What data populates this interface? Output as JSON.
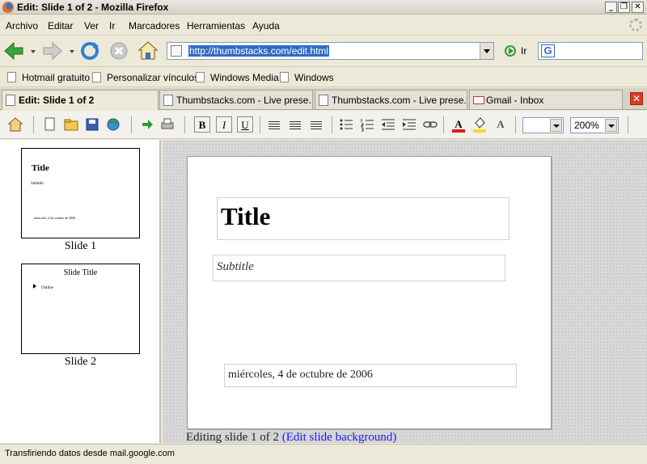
{
  "window": {
    "title": "Edit: Slide 1 of 2 - Mozilla Firefox"
  },
  "menu": {
    "items": [
      "Archivo",
      "Editar",
      "Ver",
      "Ir",
      "Marcadores",
      "Herramientas",
      "Ayuda"
    ]
  },
  "navigation": {
    "url": "http://thumbstacks.com/edit.html",
    "go_label": "Ir"
  },
  "bookmarks": [
    "Hotmail gratuito",
    "Personalizar vínculos",
    "Windows Media",
    "Windows"
  ],
  "tabs": [
    {
      "label": "Edit: Slide 1 of 2",
      "active": true
    },
    {
      "label": "Thumbstacks.com - Live prese...",
      "active": false
    },
    {
      "label": "Thumbstacks.com - Live prese...",
      "active": false
    },
    {
      "label": "Gmail - Inbox",
      "active": false
    }
  ],
  "editor_toolbar": {
    "bold": "B",
    "italic": "I",
    "underline": "U",
    "font_color_glyph": "A",
    "highlight_glyph": "A",
    "font_size_value": "",
    "zoom_value": "200%"
  },
  "sidebar": {
    "slides": [
      {
        "caption": "Slide 1",
        "title": "Title",
        "subtitle": "Subtitle",
        "date": "miércoles, 4 de octubre de 2006"
      },
      {
        "caption": "Slide 2",
        "title": "Slide Title",
        "bullet": "Outline"
      }
    ]
  },
  "slide": {
    "title": "Title",
    "subtitle": "Subtitle",
    "date": "miércoles, 4 de octubre de 2006"
  },
  "editing_status": {
    "prefix": "Editing slide 1 of 2",
    "link": "(Edit slide background)"
  },
  "statusbar": {
    "text": "Transfiriendo datos desde mail.google.com"
  },
  "colors": {
    "font_color_bar": "#d82020",
    "highlight_bar": "#f2e020",
    "link": "#1a1aff",
    "selection": "#316ac5"
  }
}
